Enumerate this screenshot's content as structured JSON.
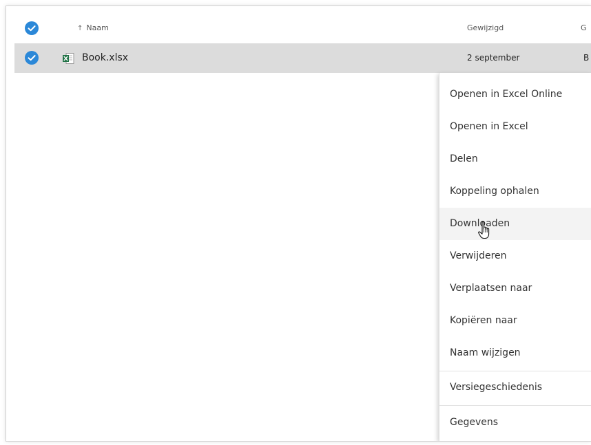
{
  "header": {
    "name_col": "Naam",
    "modified_col": "Gewijzigd",
    "cut_col": "G"
  },
  "file": {
    "name": "Book.xlsx",
    "modified": "2 september",
    "cut_value": "B"
  },
  "context_menu": {
    "items": [
      "Openen in Excel Online",
      "Openen in Excel",
      "Delen",
      "Koppeling ophalen",
      "Downloaden",
      "Verwijderen",
      "Verplaatsen naar",
      "Kopiëren naar",
      "Naam wijzigen",
      "Versiegeschiedenis",
      "Gegevens"
    ],
    "hovered_item": "Downloaden"
  },
  "colors": {
    "accent": "#2b88d8",
    "selected_row": "#dcdcdc",
    "excel_green": "#217346"
  },
  "icons": {
    "select_all": "checkmark-circle-icon",
    "row_select": "checkmark-circle-icon",
    "file_type": "excel-file-icon",
    "sort": "sort-up-arrow-icon",
    "cursor": "hand-pointer-cursor-icon"
  }
}
